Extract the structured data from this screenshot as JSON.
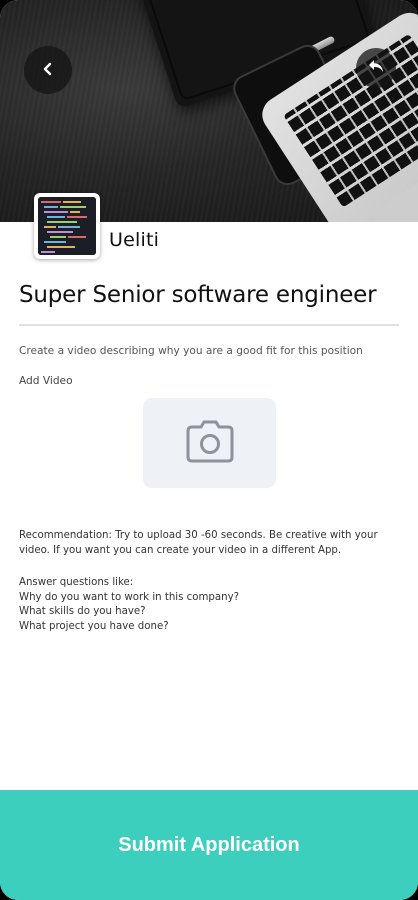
{
  "header": {
    "back_icon": "chevron-left-icon",
    "share_icon": "reply-arrow-icon"
  },
  "company": {
    "name": "Ueliti",
    "logo_icon": "code-screen-logo"
  },
  "job": {
    "title": "Super Senior software engineer"
  },
  "video": {
    "instruction": "Create a video describing why you are a good fit for this position",
    "add_label": "Add Video",
    "upload_icon": "camera-icon"
  },
  "recommendation": {
    "line1": "Recommendation: Try to upload 30 -60 seconds. Be creative with your",
    "line2": "video.  If you want you can create your video in a different App."
  },
  "questions": {
    "intro": "Answer questions like:",
    "items": [
      "Why do you want to work in this company?",
      "What skills do you have?",
      "What project you have done?"
    ]
  },
  "footer": {
    "submit_label": "Submit Application"
  },
  "colors": {
    "accent": "#3ccfbd",
    "upload_bg": "#eef1f5"
  }
}
